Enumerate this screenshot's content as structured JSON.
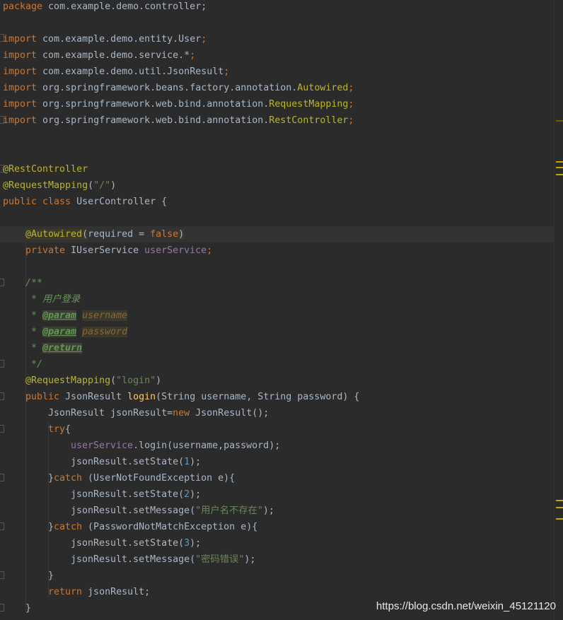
{
  "code": {
    "l1": {
      "kw": "package",
      "rest": " com.example.demo.controller;"
    },
    "imports": [
      {
        "kw": "import",
        "path": " com.example.demo.entity.User",
        "tail": ";"
      },
      {
        "kw": "import",
        "path": " com.example.demo.service.*",
        "tail": ";"
      },
      {
        "kw": "import",
        "path": " com.example.demo.util.JsonResult",
        "tail": ";"
      },
      {
        "kw": "import",
        "path": " org.springframework.beans.factory.annotation.",
        "cls": "Autowired",
        "tail": ";"
      },
      {
        "kw": "import",
        "path": " org.springframework.web.bind.annotation.",
        "cls": "RequestMapping",
        "tail": ";"
      },
      {
        "kw": "import",
        "path": " org.springframework.web.bind.annotation.",
        "cls": "RestController",
        "tail": ";"
      }
    ],
    "ann_rest": "@RestController",
    "ann_reqmap": "@RequestMapping",
    "reqmap_arg": "\"/\"",
    "class_decl_kw": "public class",
    "class_name": " UserController {",
    "autowired": "@Autowired",
    "autowired_param": "required",
    "autowired_eq": " = ",
    "autowired_val": "false",
    "field_kw": "private",
    "field_type": " IUserService ",
    "field_name": "userService",
    "doc_open": "/**",
    "doc_title": " * 用户登录",
    "doc_param_tag": "@param",
    "doc_param1": "username",
    "doc_param2": "password",
    "doc_return_tag": "@return",
    "doc_close": " */",
    "method_ann_arg": "\"login\"",
    "method_kw": "public",
    "method_ret": " JsonResult ",
    "method_name": "login",
    "method_params": "(String username, String password) {",
    "l_jr": "JsonResult jsonResult=",
    "l_jr_new": "new",
    "l_jr_tail": " JsonResult();",
    "try_kw": "try",
    "svc_call": ".login(username,password);",
    "set_state": "jsonResult.setState(",
    "state1": "1",
    "state2": "2",
    "state3": "3",
    "catch_kw": "catch",
    "catch1": " (UserNotFoundException e){",
    "catch2": " (PasswordNotMatchException e){",
    "set_msg": "jsonResult.setMessage(",
    "msg1": "\"用户名不存在\"",
    "msg2": "\"密码错误\"",
    "return_kw": "return",
    "return_val": " jsonResult;"
  },
  "watermark": "https://blog.csdn.net/weixin_45121120",
  "colors": {
    "background": "#2b2b2b",
    "keyword": "#cc7832",
    "annotation": "#bbb529",
    "string": "#6a8759",
    "field": "#9876aa",
    "method": "#ffc66d",
    "number": "#6897bb",
    "doc": "#629755",
    "marker": "#c7a800"
  }
}
